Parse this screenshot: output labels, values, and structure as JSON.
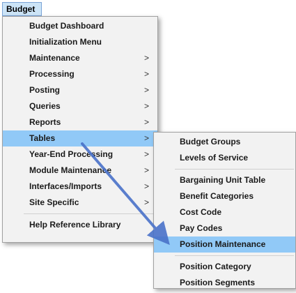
{
  "menubar": {
    "label": "Budget"
  },
  "main_menu": {
    "items": [
      {
        "label": "Budget Dashboard",
        "arrow": ""
      },
      {
        "label": "Initialization Menu",
        "arrow": ""
      },
      {
        "label": "Maintenance",
        "arrow": ">"
      },
      {
        "label": "Processing",
        "arrow": ">"
      },
      {
        "label": "Posting",
        "arrow": ">"
      },
      {
        "label": "Queries",
        "arrow": ">"
      },
      {
        "label": "Reports",
        "arrow": ">"
      },
      {
        "label": "Tables",
        "arrow": ">"
      },
      {
        "label": "Year-End Processing",
        "arrow": ">"
      },
      {
        "label": "Module Maintenance",
        "arrow": ">"
      },
      {
        "label": "Interfaces/Imports",
        "arrow": ">"
      },
      {
        "label": "Site Specific",
        "arrow": ">"
      },
      {
        "label": "Help Reference Library",
        "arrow": ""
      }
    ]
  },
  "sub_menu": {
    "items": [
      {
        "label": "Budget Groups"
      },
      {
        "label": "Levels of Service"
      },
      {
        "label": "Bargaining Unit Table"
      },
      {
        "label": "Benefit Categories"
      },
      {
        "label": "Cost Code"
      },
      {
        "label": "Pay Codes"
      },
      {
        "label": "Position Maintenance"
      },
      {
        "label": "Position Category"
      },
      {
        "label": "Position Segments"
      }
    ]
  },
  "colors": {
    "highlight": "#91c9f7",
    "annotation_arrow": "#4a72c9"
  }
}
